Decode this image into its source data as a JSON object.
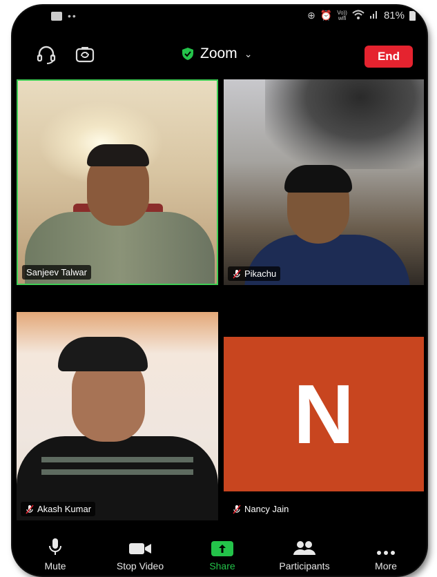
{
  "status_bar": {
    "battery": "81%",
    "volte_top": "Vo))",
    "volte_bottom": "wifi"
  },
  "top_bar": {
    "title": "Zoom",
    "end_label": "End"
  },
  "participants": [
    {
      "name": "Sanjeev Talwar",
      "muted": false
    },
    {
      "name": "Pikachu",
      "muted": true
    },
    {
      "name": "Akash Kumar",
      "muted": true
    },
    {
      "name": "Nancy Jain",
      "muted": true,
      "initial": "N"
    }
  ],
  "toolbar": {
    "mute_label": "Mute",
    "stop_video_label": "Stop Video",
    "share_label": "Share",
    "participants_label": "Participants",
    "more_label": "More"
  },
  "colors": {
    "end": "#e5232f",
    "share": "#24c34a",
    "active_speaker": "#3fcf55",
    "avatar_bg": "#c8451f"
  }
}
